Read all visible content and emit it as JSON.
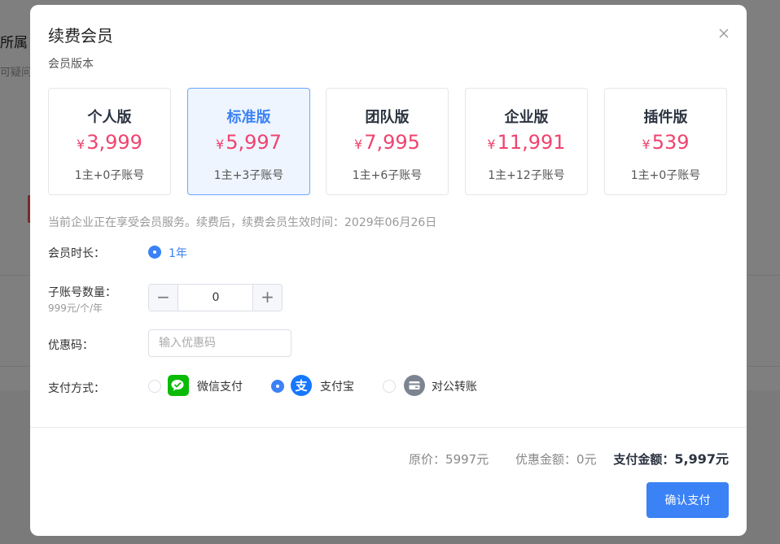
{
  "background": {
    "title": "所属",
    "subtitle": "可疑问"
  },
  "modal": {
    "title": "续费会员",
    "close_icon": "close-icon",
    "section_label": "会员版本",
    "plans": [
      {
        "name": "个人版",
        "currency": "¥",
        "price": "3,999",
        "accounts": "1主+0子账号",
        "selected": false
      },
      {
        "name": "标准版",
        "currency": "¥",
        "price": "5,997",
        "accounts": "1主+3子账号",
        "selected": true
      },
      {
        "name": "团队版",
        "currency": "¥",
        "price": "7,995",
        "accounts": "1主+6子账号",
        "selected": false
      },
      {
        "name": "企业版",
        "currency": "¥",
        "price": "11,991",
        "accounts": "1主+12子账号",
        "selected": false
      },
      {
        "name": "插件版",
        "currency": "¥",
        "price": "539",
        "accounts": "1主+0子账号",
        "selected": false
      }
    ],
    "notice": "当前企业正在享受会员服务。续费后，续费会员生效时间：2029年06月26日",
    "duration": {
      "label": "会员时长：",
      "option": "1年",
      "selected": true
    },
    "subaccounts": {
      "label": "子账号数量：",
      "sublabel": "999元/个/年",
      "minus": "−",
      "plus": "+",
      "value": "0"
    },
    "coupon": {
      "label": "优惠码：",
      "placeholder": "输入优惠码",
      "value": ""
    },
    "payment": {
      "label": "支付方式：",
      "options": [
        {
          "label": "微信支付",
          "icon": "wechat-pay-icon",
          "selected": false
        },
        {
          "label": "支付宝",
          "icon": "alipay-icon",
          "selected": true
        },
        {
          "label": "对公转账",
          "icon": "bank-transfer-icon",
          "selected": false
        }
      ]
    },
    "summary": {
      "original_label": "原价：",
      "original_value": "5997元",
      "discount_label": "优惠金额：",
      "discount_value": "0元",
      "total_label": "支付金额：",
      "total_value": "5,997元"
    },
    "confirm_label": "确认支付"
  },
  "colors": {
    "accent": "#3b82f6",
    "price": "#f0436f",
    "wechat": "#09bb07",
    "alipay": "#1677ff",
    "bank": "#7d8491"
  }
}
